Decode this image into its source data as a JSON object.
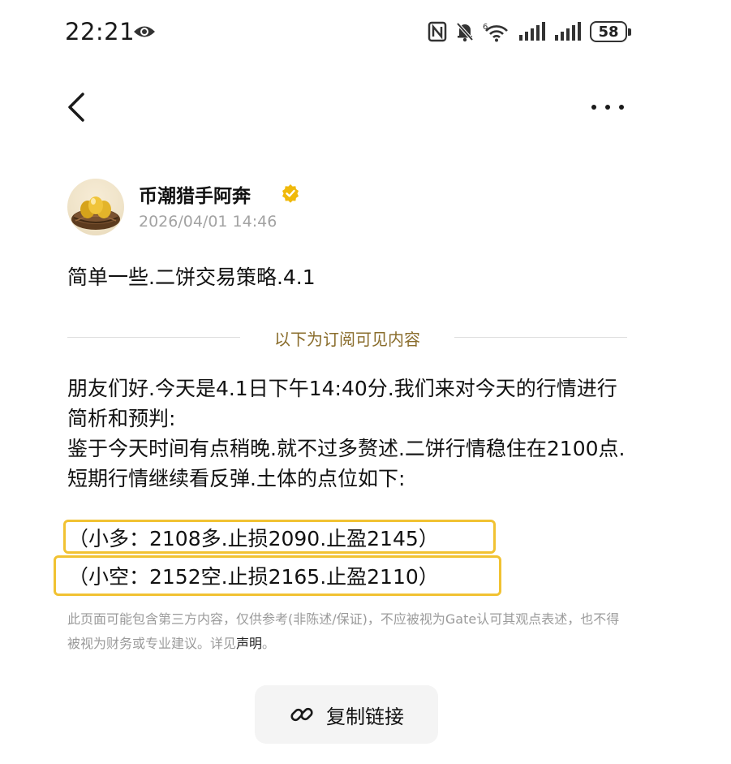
{
  "status_bar": {
    "time": "22:21",
    "battery": "58",
    "icons": [
      "eye-icon",
      "nfc-icon",
      "mute-bell-icon",
      "wifi-6-icon",
      "signal-icon",
      "signal-icon",
      "battery-icon"
    ]
  },
  "nav": {
    "back_icon": "chevron-left-icon",
    "more_icon": "more-horizontal-icon"
  },
  "post": {
    "author_name": "币潮猎手阿奔",
    "timestamp": "2026/04/01 14:46",
    "title": "简单一些.二饼交易策略.4.1",
    "subscriber_divider": "以下为订阅可见内容",
    "paragraphs": [
      "朋友们好.今天是4.1日下午14:40分.我们来对今天的行情进行简析和预判:",
      "鉴于今天时间有点稍晚.就不过多赘述.二饼行情稳住在2100点.短期行情继续看反弹.土体的点位如下:"
    ],
    "highlight_lines": [
      "（小多：2108多.止损2090.止盈2145）",
      "（小空：2152空.止损2165.止盈2110）"
    ]
  },
  "disclaimer": {
    "text": "此页面可能包含第三方内容，仅供参考(非陈述/保证)，不应被视为Gate认可其观点表述，也不得被视为财务或专业建议。详见",
    "link": "声明",
    "end": "。"
  },
  "actions": {
    "copy_link_label": "复制链接"
  },
  "colors": {
    "highlight_border": "#f1c232",
    "divider_text": "#8a6d2c",
    "verified_badge": "#f0b90b"
  }
}
